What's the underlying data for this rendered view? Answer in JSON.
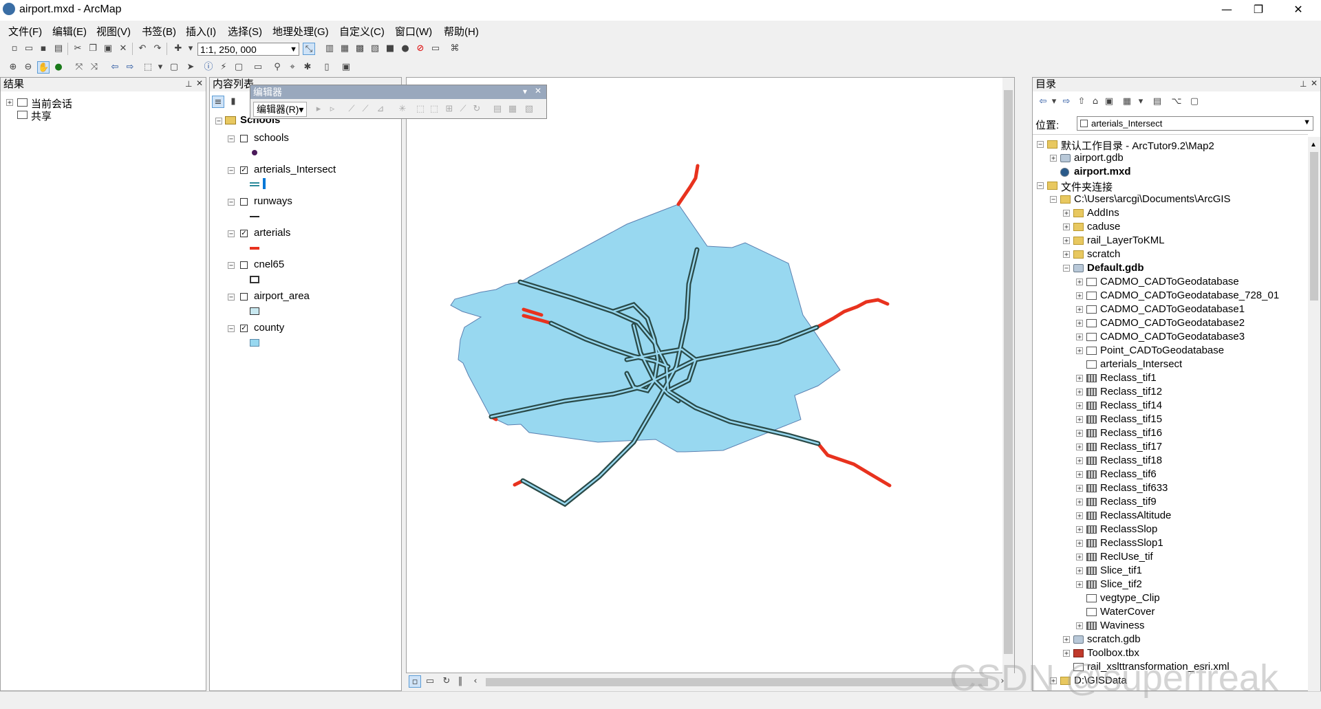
{
  "window": {
    "title": "airport.mxd - ArcMap",
    "minimize": "—",
    "restore": "❐",
    "close": "✕"
  },
  "menus": [
    "文件(F)",
    "编辑(E)",
    "视图(V)",
    "书签(B)",
    "插入(I)",
    "选择(S)",
    "地理处理(G)",
    "自定义(C)",
    "窗口(W)",
    "帮助(H)"
  ],
  "toolbar": {
    "scale": "1:1, 250, 000"
  },
  "results_panel": {
    "title": "结果",
    "items": [
      "当前会话",
      "共享"
    ]
  },
  "toc_panel": {
    "title": "内容列表",
    "group": "Schools",
    "layers": [
      {
        "name": "schools",
        "checked": false
      },
      {
        "name": "arterials_Intersect",
        "checked": true
      },
      {
        "name": "runways",
        "checked": false
      },
      {
        "name": "arterials",
        "checked": true
      },
      {
        "name": "cnel65",
        "checked": false
      },
      {
        "name": "airport_area",
        "checked": false
      },
      {
        "name": "county",
        "checked": true
      }
    ]
  },
  "editor_toolbar": {
    "title": "编辑器",
    "menu": "编辑器(R)▾"
  },
  "catalog_panel": {
    "title": "目录",
    "location_label": "位置:",
    "location_value": "arterials_Intersect",
    "tree": [
      {
        "label": "默认工作目录 - ArcTutor9.2\\Map2",
        "indent": 0,
        "exp": "−",
        "icon": "folder"
      },
      {
        "label": "airport.gdb",
        "indent": 1,
        "exp": "+",
        "icon": "gdb"
      },
      {
        "label": "airport.mxd",
        "indent": 1,
        "exp": "",
        "icon": "mxd",
        "bold": true
      },
      {
        "label": "文件夹连接",
        "indent": 0,
        "exp": "−",
        "icon": "folder"
      },
      {
        "label": "C:\\Users\\arcgi\\Documents\\ArcGIS",
        "indent": 1,
        "exp": "−",
        "icon": "folder"
      },
      {
        "label": "AddIns",
        "indent": 2,
        "exp": "+",
        "icon": "folder"
      },
      {
        "label": "caduse",
        "indent": 2,
        "exp": "+",
        "icon": "folder"
      },
      {
        "label": "rail_LayerToKML",
        "indent": 2,
        "exp": "+",
        "icon": "folder"
      },
      {
        "label": "scratch",
        "indent": 2,
        "exp": "+",
        "icon": "folder"
      },
      {
        "label": "Default.gdb",
        "indent": 2,
        "exp": "−",
        "icon": "gdb",
        "bold": true
      },
      {
        "label": "CADMO_CADToGeodatabase",
        "indent": 3,
        "exp": "+",
        "icon": "fc"
      },
      {
        "label": "CADMO_CADToGeodatabase_728_01",
        "indent": 3,
        "exp": "+",
        "icon": "fc"
      },
      {
        "label": "CADMO_CADToGeodatabase1",
        "indent": 3,
        "exp": "+",
        "icon": "fc"
      },
      {
        "label": "CADMO_CADToGeodatabase2",
        "indent": 3,
        "exp": "+",
        "icon": "fc"
      },
      {
        "label": "CADMO_CADToGeodatabase3",
        "indent": 3,
        "exp": "+",
        "icon": "fc"
      },
      {
        "label": "Point_CADToGeodatabase",
        "indent": 3,
        "exp": "+",
        "icon": "fc"
      },
      {
        "label": "arterials_Intersect",
        "indent": 3,
        "exp": "",
        "icon": "fc"
      },
      {
        "label": "Reclass_tif1",
        "indent": 3,
        "exp": "+",
        "icon": "raster"
      },
      {
        "label": "Reclass_tif12",
        "indent": 3,
        "exp": "+",
        "icon": "raster"
      },
      {
        "label": "Reclass_tif14",
        "indent": 3,
        "exp": "+",
        "icon": "raster"
      },
      {
        "label": "Reclass_tif15",
        "indent": 3,
        "exp": "+",
        "icon": "raster"
      },
      {
        "label": "Reclass_tif16",
        "indent": 3,
        "exp": "+",
        "icon": "raster"
      },
      {
        "label": "Reclass_tif17",
        "indent": 3,
        "exp": "+",
        "icon": "raster"
      },
      {
        "label": "Reclass_tif18",
        "indent": 3,
        "exp": "+",
        "icon": "raster"
      },
      {
        "label": "Reclass_tif6",
        "indent": 3,
        "exp": "+",
        "icon": "raster"
      },
      {
        "label": "Reclass_tif633",
        "indent": 3,
        "exp": "+",
        "icon": "raster"
      },
      {
        "label": "Reclass_tif9",
        "indent": 3,
        "exp": "+",
        "icon": "raster"
      },
      {
        "label": "ReclassAltitude",
        "indent": 3,
        "exp": "+",
        "icon": "raster"
      },
      {
        "label": "ReclassSlop",
        "indent": 3,
        "exp": "+",
        "icon": "raster"
      },
      {
        "label": "ReclassSlop1",
        "indent": 3,
        "exp": "+",
        "icon": "raster"
      },
      {
        "label": "ReclUse_tif",
        "indent": 3,
        "exp": "+",
        "icon": "raster"
      },
      {
        "label": "Slice_tif1",
        "indent": 3,
        "exp": "+",
        "icon": "raster"
      },
      {
        "label": "Slice_tif2",
        "indent": 3,
        "exp": "+",
        "icon": "raster"
      },
      {
        "label": "vegtype_Clip",
        "indent": 3,
        "exp": "",
        "icon": "fc"
      },
      {
        "label": "WaterCover",
        "indent": 3,
        "exp": "",
        "icon": "fc"
      },
      {
        "label": "Waviness",
        "indent": 3,
        "exp": "+",
        "icon": "raster"
      },
      {
        "label": "scratch.gdb",
        "indent": 2,
        "exp": "+",
        "icon": "gdb"
      },
      {
        "label": "Toolbox.tbx",
        "indent": 2,
        "exp": "+",
        "icon": "tbx"
      },
      {
        "label": "rail_xslttransformation_esri.xml",
        "indent": 2,
        "exp": "",
        "icon": "fc"
      },
      {
        "label": "D:\\GISData",
        "indent": 1,
        "exp": "+",
        "icon": "folder"
      }
    ]
  },
  "watermark": "CSDN @superfreak",
  "colors": {
    "county_fill": "#98d8f0",
    "arterials": "#e8321e",
    "intersect": "#2a4a48",
    "selection": "#0078d7"
  }
}
